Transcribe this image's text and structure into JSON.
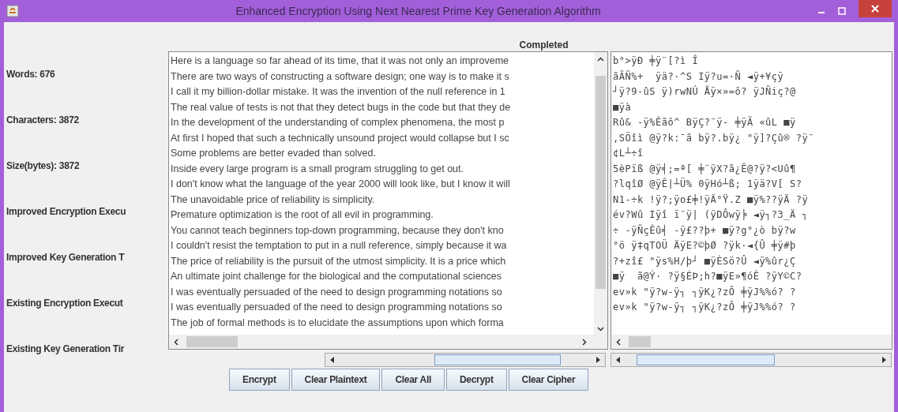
{
  "window": {
    "title": "Enhanced Encryption Using Next Nearest Prime Key Generation Algorithm"
  },
  "status": "Completed",
  "stats": [
    "Words: 676",
    "Characters: 3872",
    "Size(bytes): 3872",
    "Improved Encryption Execu",
    "Improved Key Generation T",
    "Existing Encryption Execut",
    "Existing Key Generation Tir"
  ],
  "plaintext": {
    "lines": [
      "Here is a language so far ahead of its time, that it was not only an improveme",
      "There are two ways of constructing a software design; one way is to make it s",
      "I call it my billion-dollar mistake. It was the invention of the null reference in 1",
      "The real value of tests is not that they detect bugs in the code but that they de",
      "In the development of the understanding of complex phenomena, the most p",
      "At first I hoped that such a technically unsound project would collapse but I sc",
      "Some problems are better evaded than solved.",
      "Inside every large program is a small program struggling to get out.",
      "I don't know what the language of the year 2000 will look like, but I know it will",
      "The unavoidable price of reliability is simplicity.",
      "Premature optimization is the root of all evil in programming.",
      "You cannot teach beginners top-down programming, because they don't kno",
      "I couldn't resist the temptation to put in a null reference, simply because it wa",
      "The price of reliability is the pursuit of the utmost simplicity. It is a price which",
      "An ultimate joint challenge for the biological and the computational sciences",
      "I was eventually persuaded of the need to design programming notations so",
      "I was eventually persuaded of the need to design programming notations so",
      "The job of formal methods is to elucidate the assumptions upon which forma"
    ]
  },
  "ciphertext": {
    "lines": [
      "b°>ÿÐ ╪ÿ¨[?ì Î",
      "ãÃÑ%+  ÿä?·^S Iÿ?u=·Ñ ◄ÿ+¥çÿ",
      "┘ÿ?9-ûS ÿ)rwNÚ Åÿ×»=ô? ÿJÑiç?@",
      "■ÿà",
      "Rû& -ÿ%Êãô^ BÿÇ?¨ÿ- ╪ÿÃ «ûL ■ÿ",
      ",SÖîì @ÿ?k:¯ã bÿ?.bÿ¿ \"ÿ]?Çû® ?ÿ¨",
      "¢L┴÷î",
      "5èPïß @ÿ╡;=ª[ ╪¨ÿX?ã¿Ê@?ÿ?<Uû¶",
      "?lqîØ @ÿÊ|┴Ü% 0ÿHó┴ß; 1ÿä?V[ S?",
      "N1-÷k !ÿ?;ÿo£╪!ÿÄ°Ÿ.Z ■ÿ%??ÿÄ ?ÿ",
      "év?Wû Iÿî ï¨ÿ| (ÿDÔwÿ╞ ◄ÿ┐?3_Ä ┐",
      "÷ -ÿÑçÊû╡ -ÿ£??þ+ ■ÿ?g°¿ò bÿ?w",
      "°ö ÿ‡qTOÜ ÄÿE?©þØ ?ÿk·◄{Û ╪ÿ#þ",
      "?+zî£ \"ÿs%H/þ┘ ■ÿÈSö?Û ◄ÿ%ûr¿Ç",
      "■ÿ  ã@Ý· ?ÿ§ÉÞ;h?■ÿE»¶óÊ ?ÿY©C?",
      "ev»k \"ÿ?w-ÿ┐ ┐ÿK¿?zÔ ╪ÿJ%%ó? ?",
      "ev»k \"ÿ?w-ÿ┐ ┐ÿK¿?zÔ ╪ÿJ%%ó? ?"
    ]
  },
  "buttons": [
    "Encrypt",
    "Clear Plaintext",
    "Clear All",
    "Decrypt",
    "Clear Cipher"
  ]
}
